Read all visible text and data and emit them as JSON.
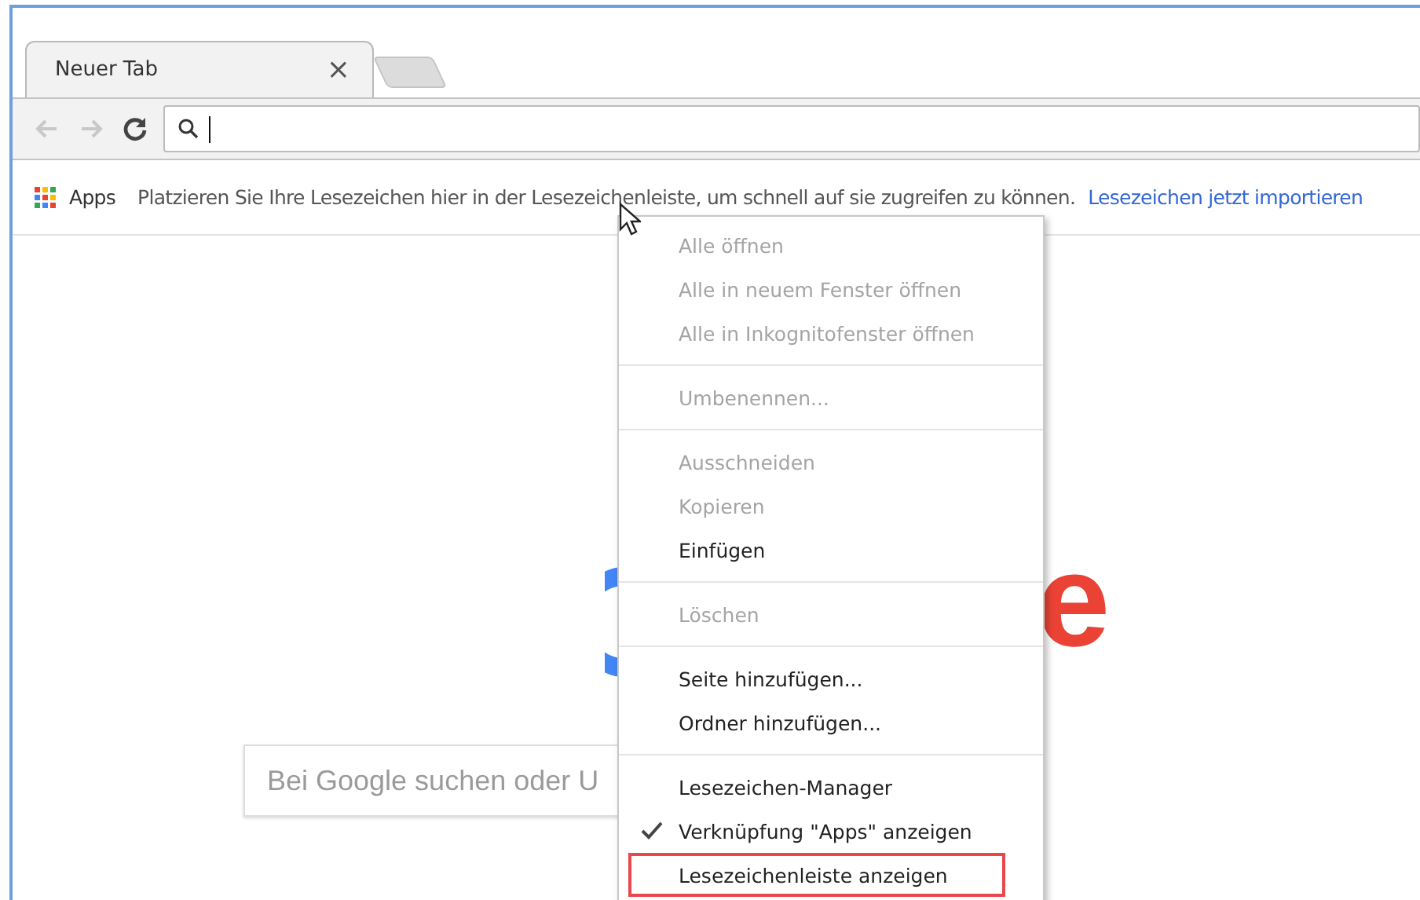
{
  "tab": {
    "title": "Neuer Tab",
    "close": "×"
  },
  "bookmarks_bar": {
    "apps": "Apps",
    "hint": "Platzieren Sie Ihre Lesezeichen hier in der Lesezeichenleiste, um schnell auf sie zugreifen zu können.",
    "import_link": "Lesezeichen jetzt importieren"
  },
  "page": {
    "logo_visible": "e",
    "search": {
      "placeholder": "Bei Google suchen oder U"
    }
  },
  "context_menu": [
    {
      "kind": "item",
      "label": "Alle öffnen",
      "disabled": true,
      "checked": false,
      "highlighted": false
    },
    {
      "kind": "item",
      "label": "Alle in neuem Fenster öffnen",
      "disabled": true,
      "checked": false,
      "highlighted": false
    },
    {
      "kind": "item",
      "label": "Alle in Inkognitofenster öffnen",
      "disabled": true,
      "checked": false,
      "highlighted": false
    },
    {
      "kind": "separator"
    },
    {
      "kind": "item",
      "label": "Umbenennen...",
      "disabled": true,
      "checked": false,
      "highlighted": false
    },
    {
      "kind": "separator"
    },
    {
      "kind": "item",
      "label": "Ausschneiden",
      "disabled": true,
      "checked": false,
      "highlighted": false
    },
    {
      "kind": "item",
      "label": "Kopieren",
      "disabled": true,
      "checked": false,
      "highlighted": false
    },
    {
      "kind": "item",
      "label": "Einfügen",
      "disabled": false,
      "checked": false,
      "highlighted": false
    },
    {
      "kind": "separator"
    },
    {
      "kind": "item",
      "label": "Löschen",
      "disabled": true,
      "checked": false,
      "highlighted": false
    },
    {
      "kind": "separator"
    },
    {
      "kind": "item",
      "label": "Seite hinzufügen...",
      "disabled": false,
      "checked": false,
      "highlighted": false
    },
    {
      "kind": "item",
      "label": "Ordner hinzufügen...",
      "disabled": false,
      "checked": false,
      "highlighted": false
    },
    {
      "kind": "separator"
    },
    {
      "kind": "item",
      "label": "Lesezeichen-Manager",
      "disabled": false,
      "checked": false,
      "highlighted": false
    },
    {
      "kind": "item",
      "label": "Verknüpfung \"Apps\" anzeigen",
      "disabled": false,
      "checked": true,
      "highlighted": false
    },
    {
      "kind": "item",
      "label": "Lesezeichenleiste anzeigen",
      "disabled": false,
      "checked": false,
      "highlighted": true
    }
  ]
}
